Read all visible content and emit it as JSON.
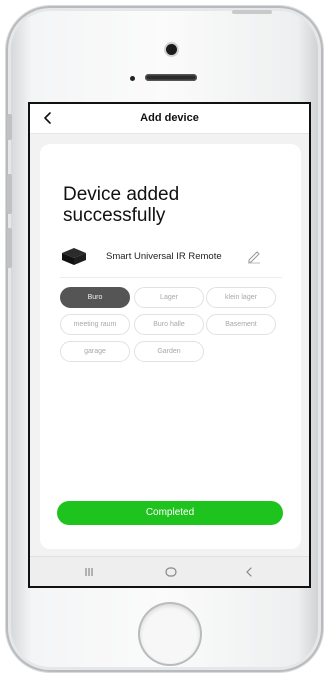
{
  "header": {
    "title": "Add device",
    "back_icon": "chevron-left-icon"
  },
  "success": {
    "title": "Device added successfully"
  },
  "device": {
    "name": "Smart Universal IR Remote",
    "icon": "ir-remote-icon",
    "edit_icon": "pencil-icon"
  },
  "rooms": [
    {
      "label": "Buro",
      "selected": true
    },
    {
      "label": "Lager",
      "selected": false
    },
    {
      "label": "klein lager",
      "selected": false
    },
    {
      "label": "meeting raum",
      "selected": false
    },
    {
      "label": "Buro halle",
      "selected": false
    },
    {
      "label": "Basement",
      "selected": false
    },
    {
      "label": "garage",
      "selected": false
    },
    {
      "label": "Garden",
      "selected": false
    }
  ],
  "actions": {
    "completed_label": "Completed"
  },
  "navbar": {
    "recents_icon": "recents-icon",
    "home_icon": "home-circle-icon",
    "back_icon": "back-chevron-icon"
  },
  "colors": {
    "accent": "#1ec31e",
    "chip_selected": "#555555"
  }
}
